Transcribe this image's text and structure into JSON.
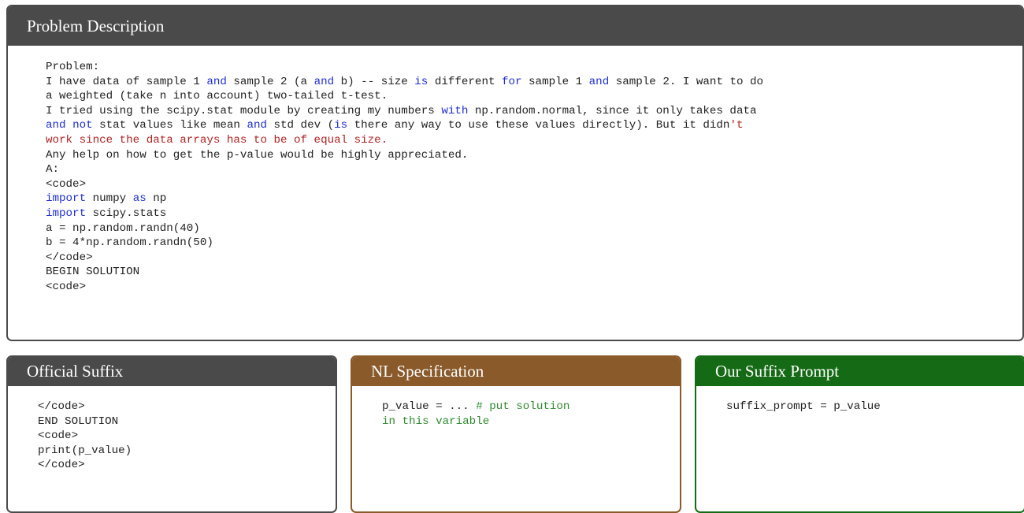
{
  "problem": {
    "title": "Problem Description",
    "lines": [
      [
        {
          "t": "Problem:"
        }
      ],
      [
        {
          "t": "I have data of sample 1 "
        },
        {
          "t": "and",
          "c": "kw"
        },
        {
          "t": " sample 2 (a "
        },
        {
          "t": "and",
          "c": "kw"
        },
        {
          "t": " b) -- size "
        },
        {
          "t": "is",
          "c": "kw"
        },
        {
          "t": " different "
        },
        {
          "t": "for",
          "c": "kw"
        },
        {
          "t": " sample 1 "
        },
        {
          "t": "and",
          "c": "kw"
        },
        {
          "t": " sample 2. I want to do"
        }
      ],
      [
        {
          "t": "a weighted (take n into account) two-tailed t-test."
        }
      ],
      [
        {
          "t": "I tried using the scipy.stat module by creating my numbers "
        },
        {
          "t": "with",
          "c": "kw"
        },
        {
          "t": " np.random.normal, since it only takes data"
        }
      ],
      [
        {
          "t": "and",
          "c": "kw"
        },
        {
          "t": " "
        },
        {
          "t": "not",
          "c": "kw"
        },
        {
          "t": " stat values like mean "
        },
        {
          "t": "and",
          "c": "kw"
        },
        {
          "t": " std dev ("
        },
        {
          "t": "is",
          "c": "kw"
        },
        {
          "t": " there any way to use these values directly). But it didn"
        },
        {
          "t": "'t",
          "c": "str"
        }
      ],
      [
        {
          "t": "work since the data arrays has to be of equal size.",
          "c": "str"
        }
      ],
      [
        {
          "t": "Any help on how to get the p-value would be highly appreciated."
        }
      ],
      [
        {
          "t": "A:"
        }
      ],
      [
        {
          "t": "<code>"
        }
      ],
      [
        {
          "t": "import",
          "c": "kw"
        },
        {
          "t": " numpy "
        },
        {
          "t": "as",
          "c": "kw"
        },
        {
          "t": " np"
        }
      ],
      [
        {
          "t": "import",
          "c": "kw"
        },
        {
          "t": " scipy.stats"
        }
      ],
      [
        {
          "t": "a = np.random.randn(40)"
        }
      ],
      [
        {
          "t": "b = 4*np.random.randn(50)"
        }
      ],
      [
        {
          "t": "</code>"
        }
      ],
      [
        {
          "t": "BEGIN SOLUTION"
        }
      ],
      [
        {
          "t": "<code>"
        }
      ]
    ]
  },
  "official_suffix": {
    "title": "Official Suffix",
    "lines": [
      [
        {
          "t": "</code>"
        }
      ],
      [
        {
          "t": "END SOLUTION"
        }
      ],
      [
        {
          "t": "<code>"
        }
      ],
      [
        {
          "t": "print(p_value)"
        }
      ],
      [
        {
          "t": "</code>"
        }
      ]
    ]
  },
  "nl_specification": {
    "title": "NL Specification",
    "lines": [
      [
        {
          "t": "p_value = ... "
        },
        {
          "t": "# put solution",
          "c": "cm"
        }
      ],
      [
        {
          "t": "in this variable",
          "c": "cm"
        }
      ]
    ]
  },
  "our_suffix_prompt": {
    "title": "Our Suffix Prompt",
    "lines": [
      [
        {
          "t": "suffix_prompt = p_value"
        }
      ]
    ]
  },
  "colors": {
    "problem_header": "#4a4a4a",
    "official_suffix_header": "#4a4a4a",
    "nl_specification_header": "#8a5a2b",
    "our_suffix_prompt_header": "#156b15",
    "keyword": "#1f2fd6",
    "string": "#b22222",
    "comment": "#2e8b2e"
  }
}
